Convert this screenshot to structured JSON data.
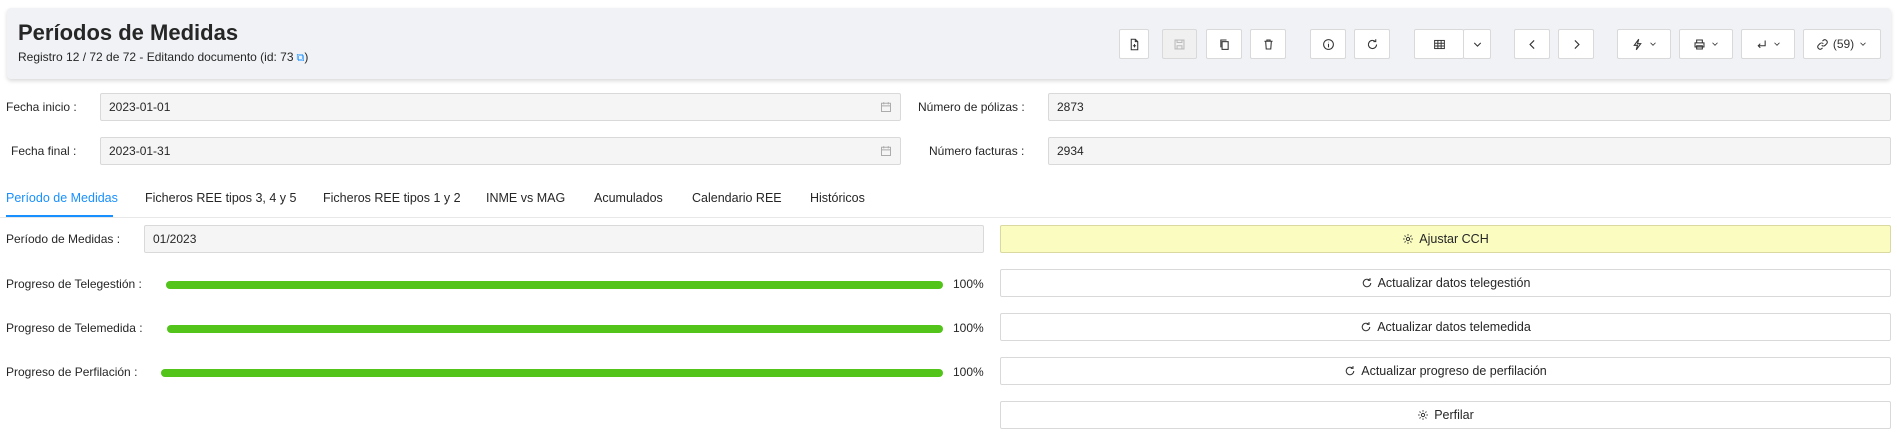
{
  "header": {
    "title": "Períodos de Medidas",
    "subtitle": "Registro 12 / 72 de 72 - Editando documento (id: 73",
    "subtitle_suffix": ")"
  },
  "toolbar": {
    "relations_label": "(59)"
  },
  "form": {
    "fecha_inicio_label": "Fecha inicio :",
    "fecha_inicio_value": "2023-01-01",
    "fecha_final_label": "Fecha final :",
    "fecha_final_value": "2023-01-31",
    "num_polizas_label": "Número de pólizas :",
    "num_polizas_value": "2873",
    "num_facturas_label": "Número facturas :",
    "num_facturas_value": "2934"
  },
  "tabs": [
    {
      "label": "Período de Medidas",
      "active": true
    },
    {
      "label": "Ficheros REE tipos 3, 4 y 5"
    },
    {
      "label": "Ficheros REE tipos 1 y 2"
    },
    {
      "label": "INME vs MAG"
    },
    {
      "label": "Acumulados"
    },
    {
      "label": "Calendario REE"
    },
    {
      "label": "Históricos"
    }
  ],
  "periodo": {
    "label": "Período de Medidas :",
    "value": "01/2023"
  },
  "progress": [
    {
      "label": "Progreso de Telegestión :",
      "value": 1.0,
      "text": "100%"
    },
    {
      "label": "Progreso de Telemedida :",
      "value": 1.0,
      "text": "100%"
    },
    {
      "label": "Progreso de Perfilación :",
      "value": 1.0,
      "text": "100%"
    }
  ],
  "actions": {
    "ajustar": "Ajustar CCH",
    "telegestion": "Actualizar datos telegestión",
    "telemedida": "Actualizar datos telemedida",
    "perfilacion": "Actualizar progreso de perfilación",
    "perfilar": "Perfilar"
  },
  "colors": {
    "accent": "#1890ff",
    "progress": "#52c41a",
    "highlight": "#fafcc0"
  }
}
